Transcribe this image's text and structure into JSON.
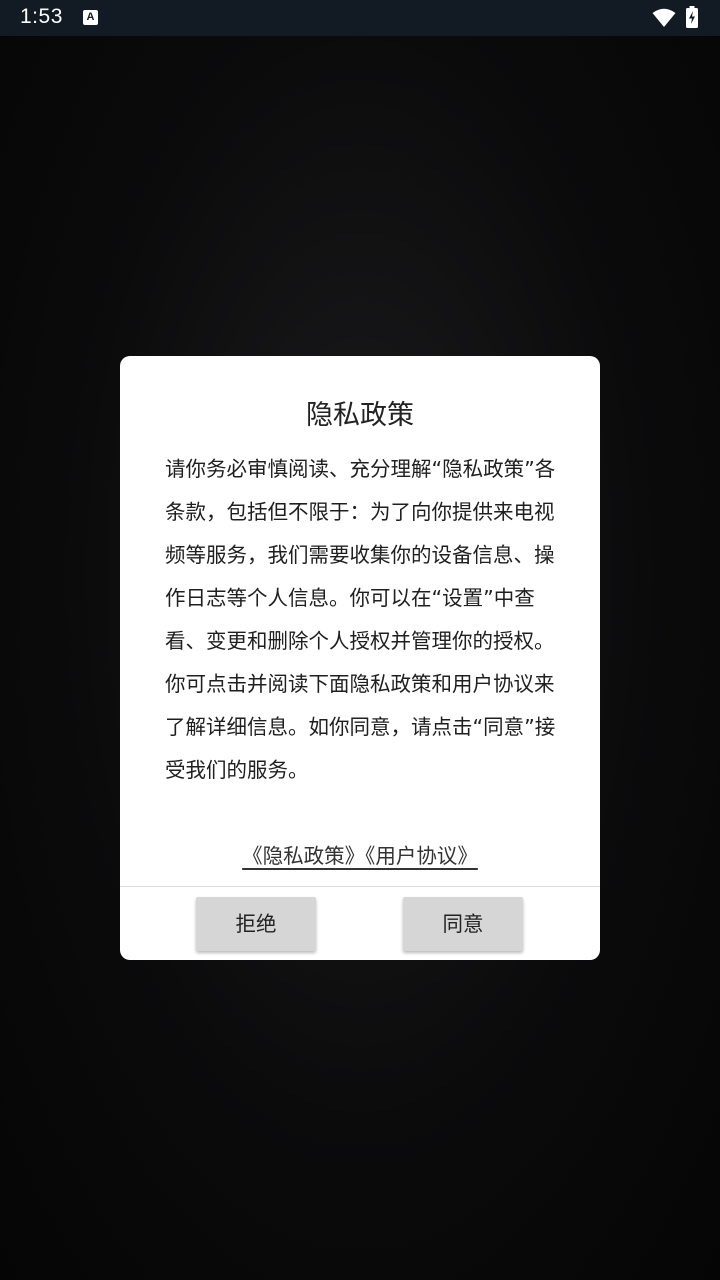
{
  "status_bar": {
    "time": "1:53",
    "notification_icon_label": "A",
    "icons": [
      "a-notification-icon",
      "wifi-icon",
      "battery-charging-icon"
    ]
  },
  "dialog": {
    "title": "隐私政策",
    "paragraphs": [
      "请你务必审慎阅读、充分理解“隐私政策”各条款，包括但不限于：为了向你提供来电视频等服务，我们需要收集你的设备信息、操作日志等个人信息。你可以在“设置”中查看、变更和删除个人授权并管理你的授权。",
      "你可点击并阅读下面隐私政策和用户协议来了解详细信息。如你同意，请点击“同意”接受我们的服务。"
    ],
    "links_text": "《隐私政策》《用户协议》",
    "reject_label": "拒绝",
    "agree_label": "同意"
  },
  "colors": {
    "status_bar_bg": "#121a24",
    "dialog_bg": "#ffffff",
    "button_bg": "#d6d6d6"
  }
}
